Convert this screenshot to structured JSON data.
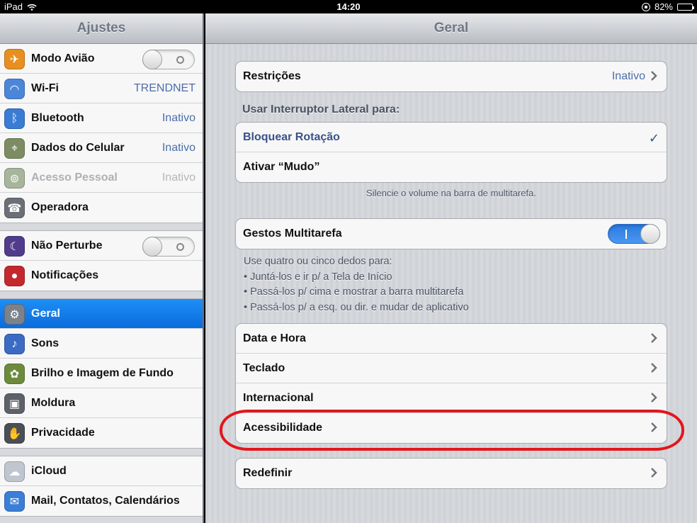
{
  "statusbar": {
    "device": "iPad",
    "time": "14:20",
    "battery": "82%",
    "battery_level": 0.82
  },
  "sidebar": {
    "title": "Ajustes",
    "groups": [
      [
        {
          "label": "Modo Avião",
          "control": "toggle-off",
          "icon": "airplane-icon",
          "color": "#e88f1f"
        },
        {
          "label": "Wi-Fi",
          "value": "TRENDNET",
          "icon": "wifi-icon",
          "color": "#4c86d9"
        },
        {
          "label": "Bluetooth",
          "value": "Inativo",
          "icon": "bluetooth-icon",
          "color": "#3a7bd5"
        },
        {
          "label": "Dados do Celular",
          "value": "Inativo",
          "icon": "cellular-icon",
          "color": "#7c8d63"
        },
        {
          "label": "Acesso Pessoal",
          "value": "Inativo",
          "icon": "personal-hotspot-icon",
          "color": "#a6b59b",
          "disabled": true
        },
        {
          "label": "Operadora",
          "icon": "phone-icon",
          "color": "#6b7078"
        }
      ],
      [
        {
          "label": "Não Perturbe",
          "control": "toggle-off",
          "icon": "moon-icon",
          "color": "#503b8c"
        },
        {
          "label": "Notificações",
          "icon": "notifications-icon",
          "color": "#c4282c"
        }
      ],
      [
        {
          "label": "Geral",
          "icon": "gear-icon",
          "color": "#7b828c",
          "selected": true
        },
        {
          "label": "Sons",
          "icon": "speaker-icon",
          "color": "#3b6bc4"
        },
        {
          "label": "Brilho e Imagem de Fundo",
          "icon": "flower-icon",
          "color": "#6e8b3d"
        },
        {
          "label": "Moldura",
          "icon": "picture-frame-icon",
          "color": "#5d6168"
        },
        {
          "label": "Privacidade",
          "icon": "hand-icon",
          "color": "#4a4e55"
        }
      ],
      [
        {
          "label": "iCloud",
          "icon": "cloud-icon",
          "color": "#bfc6cf"
        },
        {
          "label": "Mail, Contatos, Calendários",
          "icon": "mail-icon",
          "color": "#3a7ed8"
        }
      ]
    ]
  },
  "detail": {
    "title": "Geral",
    "restrictions": {
      "label": "Restrições",
      "value": "Inativo"
    },
    "side_switch": {
      "header": "Usar Interruptor Lateral para:",
      "options": [
        "Bloquear Rotação",
        "Ativar “Mudo”"
      ],
      "footer": "Silencie o volume na barra de multitarefa."
    },
    "gestures": {
      "label": "Gestos Multitarefa",
      "on": true,
      "notes": [
        "Use quatro ou cinco dedos para:",
        "• Juntá-los e ir p/ a Tela de Início",
        "• Passá-los p/ cima e mostrar a barra multitarefa",
        "• Passá-los p/ a esq. ou dir. e mudar de aplicativo"
      ]
    },
    "items": [
      "Data e Hora",
      "Teclado",
      "Internacional",
      "Acessibilidade"
    ],
    "reset": "Redefinir"
  },
  "colors": {
    "selected": "#0a6bdc",
    "value_text": "#4b6eab",
    "annotation": "#e3161b"
  }
}
